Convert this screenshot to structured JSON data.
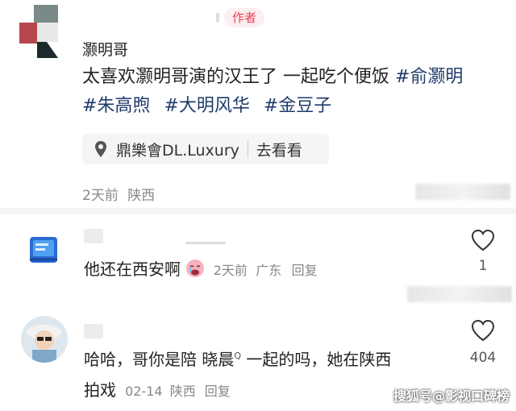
{
  "post": {
    "author_name": "灏明哥",
    "author_badge": "作者",
    "line1_text": "太喜欢灏明哥演的汉王了  一起吃个便饭 ",
    "line1_tag": "#俞灏明",
    "line2_tags": [
      "#朱高煦",
      "#大明风华",
      "#金豆子"
    ],
    "location": "鼎樂會DL.Luxury",
    "location_action": "去看看",
    "time": "2天前",
    "region": "陕西",
    "pin_icon": "location-pin-icon"
  },
  "comments": [
    {
      "text": "他还在西安啊",
      "emoji": "crying-face-emoji",
      "time": "2天前",
      "region": "广东",
      "reply_label": "回复",
      "likes": "1"
    },
    {
      "text_part1": "哈哈，哥你是陪 ",
      "mention": "晓晨",
      "text_part2": " 一起的吗，她在陕西",
      "text_line2": "拍戏",
      "time": "02-14",
      "region": "陕西",
      "reply_label": "回复",
      "likes": "404"
    }
  ],
  "watermark": "搜狐号@影视口碑榜",
  "colors": {
    "badge_bg": "#fdeef0",
    "badge_text": "#ef3d55",
    "hashtag": "#1f3a6b",
    "meta": "#888888"
  }
}
